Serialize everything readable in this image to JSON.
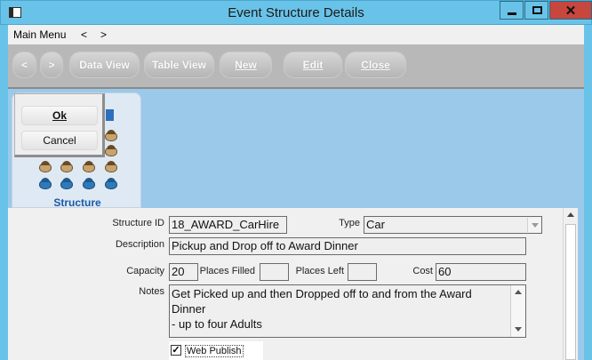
{
  "window": {
    "title": "Event Structure Details"
  },
  "menu": {
    "main_menu": "Main Menu",
    "back": "<",
    "forward": ">"
  },
  "toolbar": {
    "prev": "<",
    "next": ">",
    "data_view": "Data View",
    "table_view": "Table View",
    "new": "New",
    "edit": "Edit",
    "close": "Close"
  },
  "popup": {
    "ok": "Ok",
    "cancel": "Cancel"
  },
  "side_tab": {
    "label": "Structure"
  },
  "form": {
    "structure_id_label": "Structure ID",
    "structure_id": "18_AWARD_CarHire",
    "type_label": "Type",
    "type": "Car",
    "description_label": "Description",
    "description": "Pickup and Drop off to Award Dinner",
    "capacity_label": "Capacity",
    "capacity": "20",
    "places_filled_label": "Places Filled",
    "places_filled": "",
    "places_left_label": "Places Left",
    "places_left": "",
    "cost_label": "Cost",
    "cost": "60",
    "notes_label": "Notes",
    "notes_line1": "Get Picked up and then Dropped off to and from the Award Dinner",
    "notes_line2": "- up to four Adults",
    "web_publish_label": "Web Publish",
    "web_publish_checked": true
  },
  "colors": {
    "titlebar": "#69c3e8",
    "content_bg": "#9bc9ea",
    "close_button": "#c7463e",
    "tab_label": "#1a5aa8"
  }
}
